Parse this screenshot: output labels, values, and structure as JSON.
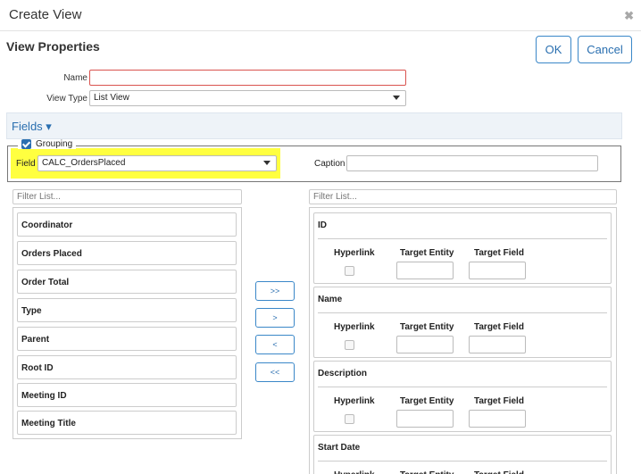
{
  "dialog": {
    "title": "Create View",
    "close_icon": "✖"
  },
  "header": {
    "section_title": "View Properties",
    "ok_label": "OK",
    "cancel_label": "Cancel"
  },
  "form": {
    "name_label": "Name",
    "name_value": "",
    "view_type_label": "View Type",
    "view_type_value": "List View"
  },
  "fields": {
    "toggle_label": "Fields ▾",
    "grouping": {
      "label": "Grouping",
      "checked": true,
      "field_label": "Field",
      "field_value": "CALC_OrdersPlaced",
      "caption_label": "Caption",
      "caption_value": ""
    }
  },
  "available": {
    "filter_placeholder": "Filter List...",
    "items": [
      "Coordinator",
      "Orders Placed",
      "Order Total",
      "Type",
      "Parent",
      "Root ID",
      "Meeting ID",
      "Meeting Title"
    ]
  },
  "move_buttons": {
    "add_all": ">>",
    "add": ">",
    "remove": "<",
    "remove_all": "<<"
  },
  "selected": {
    "filter_placeholder": "Filter List...",
    "columns": {
      "hyperlink": "Hyperlink",
      "target_entity": "Target Entity",
      "target_field": "Target Field"
    },
    "items": [
      {
        "title": "ID"
      },
      {
        "title": "Name"
      },
      {
        "title": "Description"
      },
      {
        "title": "Start Date"
      }
    ]
  },
  "colors": {
    "accent": "#2a6fb0",
    "highlight": "#ffff40",
    "error_border": "#d9534f"
  }
}
